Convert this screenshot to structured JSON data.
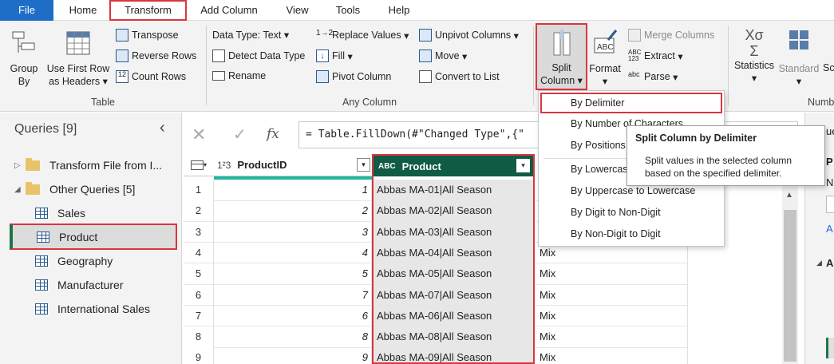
{
  "menu": {
    "tabs": [
      "File",
      "Home",
      "Transform",
      "Add Column",
      "View",
      "Tools",
      "Help"
    ]
  },
  "ribbon": {
    "group_by": [
      "Group",
      "By"
    ],
    "use_first_row": [
      "Use First Row",
      "as Headers"
    ],
    "transpose": "Transpose",
    "reverse_rows": "Reverse Rows",
    "count_rows": "Count Rows",
    "table_group": "Table",
    "data_type": "Data Type: Text",
    "detect_data_type": "Detect Data Type",
    "rename": "Rename",
    "replace_values": "Replace Values",
    "fill": "Fill",
    "pivot_column": "Pivot Column",
    "unpivot_columns": "Unpivot Columns",
    "move": "Move",
    "convert_to_list": "Convert to List",
    "any_column_group": "Any Column",
    "split_column": [
      "Split",
      "Column"
    ],
    "format": "Format",
    "merge_columns": "Merge Columns",
    "extract": "Extract",
    "parse": "Parse",
    "statistics": "Statistics",
    "standard": "Standard",
    "scientific_partial": "Sc",
    "number_group_partial": "Numb",
    "abc_123": "ABC\n123",
    "abc": "abc",
    "format_icon_text": "ABC",
    "sum_symbol": "Σ",
    "xo_symbol": "Χσ"
  },
  "queries": {
    "title": "Queries [9]",
    "collapse_icon": "‹",
    "groups": [
      {
        "label": "Transform File from I...",
        "expanded": false
      },
      {
        "label": "Other Queries [5]",
        "expanded": true
      }
    ],
    "items": [
      "Sales",
      "Product",
      "Geography",
      "Manufacturer",
      "International Sales"
    ]
  },
  "formula": {
    "text": "= Table.FillDown(#\"Changed Type\",{\""
  },
  "grid": {
    "col_productid": "ProductID",
    "col_product": "Product",
    "type_123": "1²3",
    "type_abc": "ABC",
    "rows": [
      {
        "n": "1",
        "id": "1",
        "product": "Abbas MA-01|All Season",
        "extra": ""
      },
      {
        "n": "2",
        "id": "2",
        "product": "Abbas MA-02|All Season",
        "extra": ""
      },
      {
        "n": "3",
        "id": "3",
        "product": "Abbas MA-03|All Season",
        "extra": ""
      },
      {
        "n": "4",
        "id": "4",
        "product": "Abbas MA-04|All Season",
        "extra": "Mix"
      },
      {
        "n": "5",
        "id": "5",
        "product": "Abbas MA-05|All Season",
        "extra": "Mix"
      },
      {
        "n": "6",
        "id": "7",
        "product": "Abbas MA-07|All Season",
        "extra": "Mix"
      },
      {
        "n": "7",
        "id": "6",
        "product": "Abbas MA-06|All Season",
        "extra": "Mix"
      },
      {
        "n": "8",
        "id": "8",
        "product": "Abbas MA-08|All Season",
        "extra": "Mix"
      },
      {
        "n": "9",
        "id": "9",
        "product": "Abbas MA-09|All Season",
        "extra": "Mix"
      }
    ]
  },
  "dropdown": {
    "items": [
      "By Delimiter",
      "By Number of Characters",
      "By Positions",
      "By Lowercase to Uppercase",
      "By Uppercase to Lowercase",
      "By Digit to Non-Digit",
      "By Non-Digit to Digit"
    ]
  },
  "tooltip": {
    "title": "Split Column by Delimiter",
    "body": "Split values in the selected column based on the specified delimiter."
  },
  "rightpane": {
    "letters": [
      "ue",
      "P",
      "N",
      "A",
      "A"
    ]
  },
  "colors": {
    "accent": "#1e6ec8",
    "highlight": "#d9363e",
    "product_header": "#0f5b45",
    "selected_query_bar": "#217346"
  }
}
